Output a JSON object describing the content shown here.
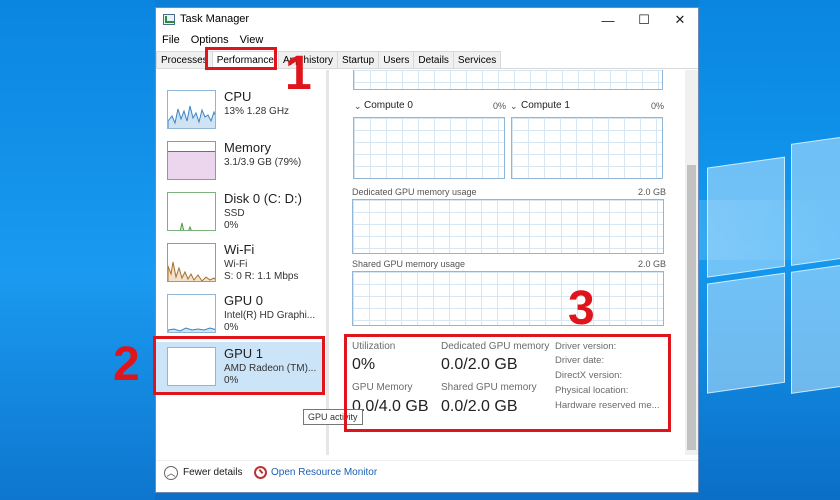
{
  "window": {
    "title": "Task Manager",
    "controls": {
      "minimize": "—",
      "maximize": "☐",
      "close": "✕"
    }
  },
  "menu": [
    "File",
    "Options",
    "View"
  ],
  "tabs": [
    "Processes",
    "Performance",
    "App history",
    "Startup",
    "Users",
    "Details",
    "Services"
  ],
  "resources": [
    {
      "name": "CPU",
      "line1": "13% 1.28 GHz",
      "line2": ""
    },
    {
      "name": "Memory",
      "line1": "3.1/3.9 GB (79%)",
      "line2": ""
    },
    {
      "name": "Disk 0 (C: D:)",
      "line1": "SSD",
      "line2": "0%"
    },
    {
      "name": "Wi-Fi",
      "line1": "Wi-Fi",
      "line2": "S: 0 R: 1.1 Mbps"
    },
    {
      "name": "GPU 0",
      "line1": "Intel(R) HD Graphi...",
      "line2": "0%"
    },
    {
      "name": "GPU 1",
      "line1": "AMD Radeon (TM)...",
      "line2": "0%"
    }
  ],
  "detail": {
    "compute0": {
      "label": "Compute 0",
      "pct": "0%"
    },
    "compute1": {
      "label": "Compute 1",
      "pct": "0%"
    },
    "dedicated_graph": {
      "label": "Dedicated GPU memory usage",
      "max": "2.0 GB"
    },
    "shared_graph": {
      "label": "Shared GPU memory usage",
      "max": "2.0 GB"
    },
    "stats": {
      "utilization_label": "Utilization",
      "utilization_value": "0%",
      "dedicated_label": "Dedicated GPU memory",
      "dedicated_value": "0.0/2.0 GB",
      "gpu_memory_label": "GPU Memory",
      "gpu_memory_value": "0.0/4.0 GB",
      "shared_label": "Shared GPU memory",
      "shared_value": "0.0/2.0 GB"
    },
    "driver": [
      "Driver version:",
      "Driver date:",
      "DirectX version:",
      "Physical location:",
      "Hardware reserved me..."
    ]
  },
  "tooltip": "GPU activity",
  "footer": {
    "fewer_details": "Fewer details",
    "open_monitor": "Open Resource Monitor"
  },
  "callouts": [
    "1",
    "2",
    "3"
  ],
  "colors": {
    "highlight": "#e0141b",
    "selection": "#cce4f7",
    "link": "#1a5fb4"
  }
}
